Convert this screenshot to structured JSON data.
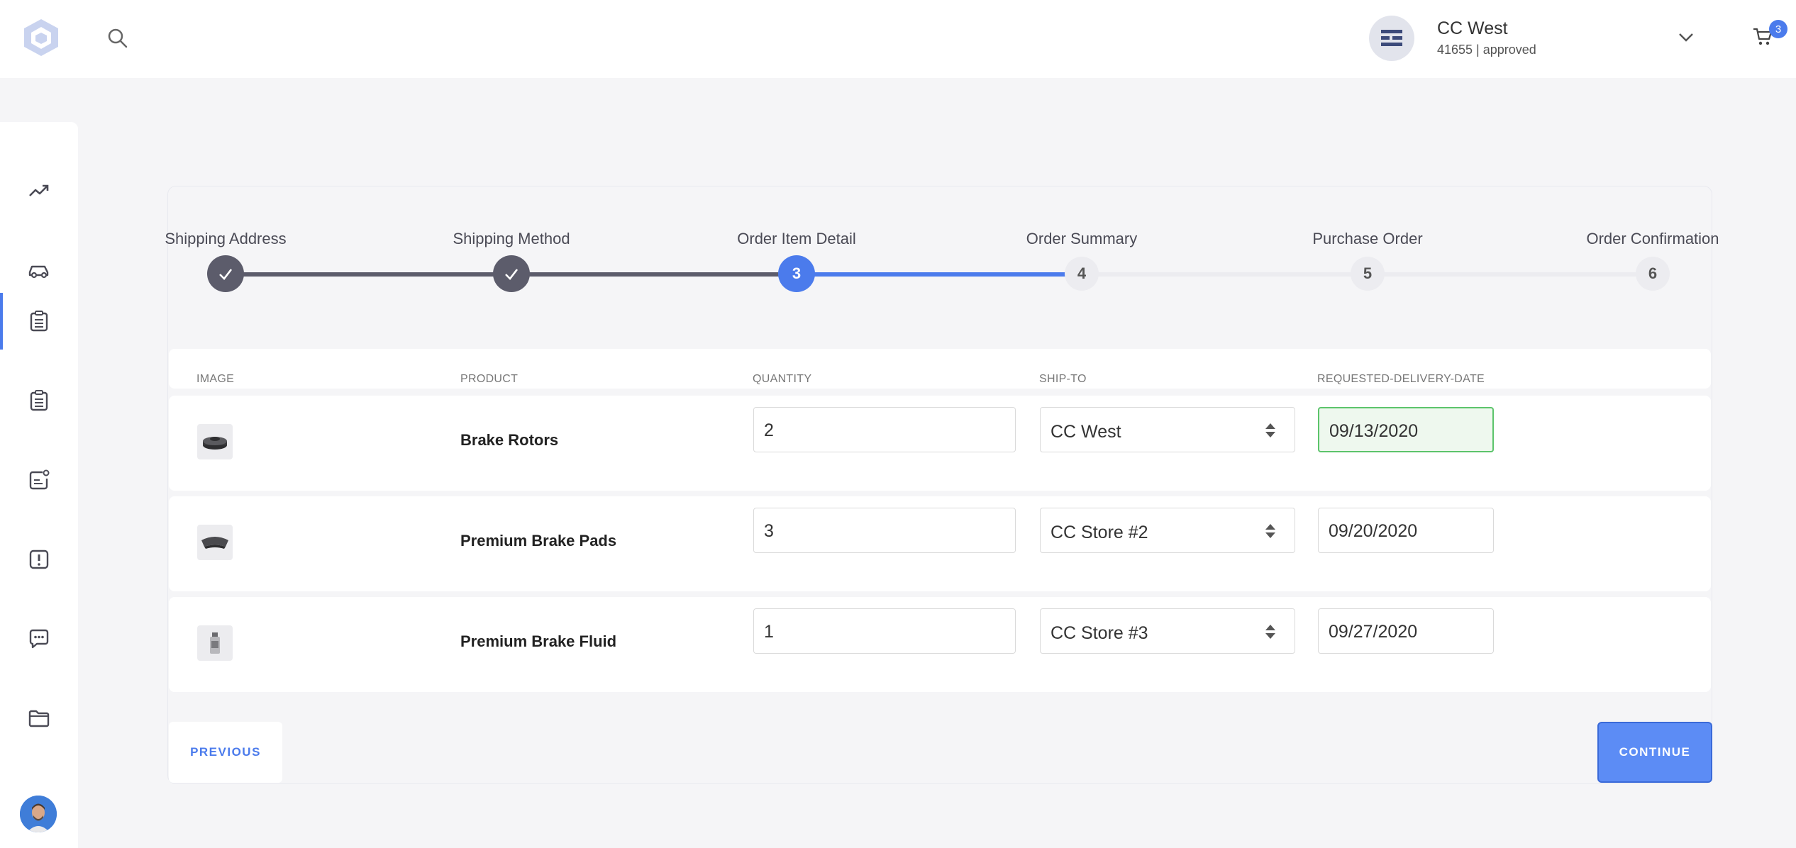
{
  "header": {
    "account_name": "CC West",
    "account_sub": "41655 | approved",
    "cart_count": "3"
  },
  "sidebar": {
    "items": [
      {
        "icon": "trending-up-icon"
      },
      {
        "icon": "car-icon"
      },
      {
        "icon": "clipboard-list-icon",
        "active": true
      },
      {
        "icon": "clipboard-check-icon"
      },
      {
        "icon": "contact-card-icon"
      },
      {
        "icon": "alert-icon"
      },
      {
        "icon": "chat-icon"
      },
      {
        "icon": "folder-icon"
      }
    ]
  },
  "stepper": {
    "steps": [
      {
        "label": "Shipping Address",
        "number": "1",
        "state": "done"
      },
      {
        "label": "Shipping Method",
        "number": "2",
        "state": "done"
      },
      {
        "label": "Order Item Detail",
        "number": "3",
        "state": "active"
      },
      {
        "label": "Order Summary",
        "number": "4",
        "state": "todo"
      },
      {
        "label": "Purchase Order",
        "number": "5",
        "state": "todo"
      },
      {
        "label": "Order Confirmation",
        "number": "6",
        "state": "todo"
      }
    ]
  },
  "table": {
    "headers": [
      "IMAGE",
      "PRODUCT",
      "QUANTITY",
      "SHIP-TO",
      "REQUESTED-DELIVERY-DATE"
    ],
    "rows": [
      {
        "product": "Brake Rotors",
        "quantity": "2",
        "ship_to": "CC West",
        "date": "09/13/2020"
      },
      {
        "product": "Premium Brake Pads",
        "quantity": "3",
        "ship_to": "CC Store #2",
        "date": "09/20/2020"
      },
      {
        "product": "Premium Brake Fluid",
        "quantity": "1",
        "ship_to": "CC Store #3",
        "date": "09/27/2020"
      }
    ]
  },
  "actions": {
    "previous": "PREVIOUS",
    "continue": "CONTINUE"
  },
  "colors": {
    "accent": "#4b7bec",
    "done": "#5c5c6b",
    "focus_border": "#5cc46b"
  }
}
